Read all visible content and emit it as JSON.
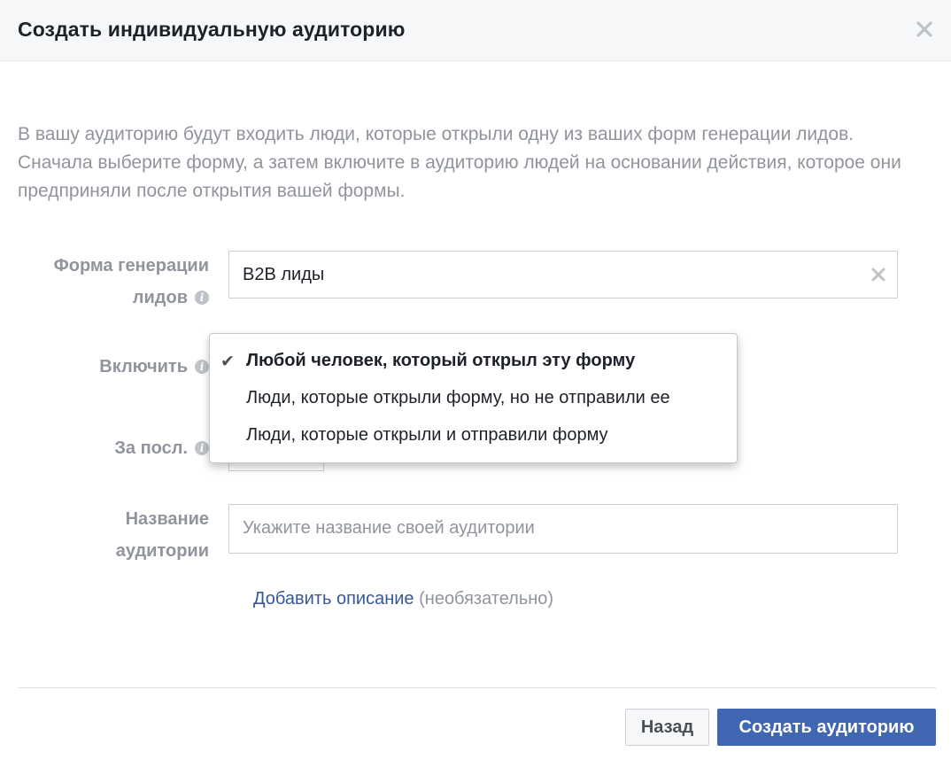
{
  "dialog": {
    "title": "Создать индивидуальную аудиторию",
    "close_icon": "close-icon",
    "description": "В вашу аудиторию будут входить люди, которые открыли одну из ваших форм генерации лидов. Сначала выберите форму, а затем включите в аудиторию людей на основании действия, которое они предприняли после открытия вашей формы."
  },
  "form": {
    "lead_form": {
      "label_line1": "Форма генерации",
      "label_line2": "лидов",
      "value": "B2B лиды",
      "info_icon": "info-icon",
      "clear_icon": "clear-icon"
    },
    "include": {
      "label": "Включить",
      "info_icon": "info-icon"
    },
    "period": {
      "label": "За посл.",
      "info_icon": "info-icon"
    },
    "audience_name": {
      "label_line1": "Название",
      "label_line2": "аудитории",
      "placeholder": "Укажите название своей аудитории"
    },
    "add_description": {
      "link": "Добавить описание",
      "optional": "(необязательно)"
    }
  },
  "dropdown": {
    "check_glyph": "✔",
    "options": [
      {
        "label": "Любой человек, который открыл эту форму",
        "selected": true
      },
      {
        "label": "Люди, которые открыли форму, но не отправили ее",
        "selected": false
      },
      {
        "label": "Люди, которые открыли и отправили форму",
        "selected": false
      }
    ]
  },
  "footer": {
    "back_label": "Назад",
    "create_label": "Создать аудиторию"
  },
  "colors": {
    "primary_button": "#4267b2",
    "link": "#365899",
    "muted_text": "#90949c"
  }
}
